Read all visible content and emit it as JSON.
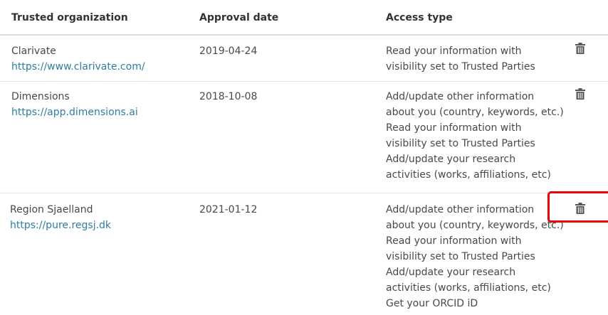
{
  "headers": {
    "organization": "Trusted organization",
    "approval_date": "Approval date",
    "access_type": "Access type"
  },
  "rows": [
    {
      "name": "Clarivate",
      "url": "https://www.clarivate.com/",
      "date": "2019-04-24",
      "access": [
        "Read your information with",
        "visibility set to Trusted Parties"
      ],
      "delete_icon": "trash-icon"
    },
    {
      "name": "Dimensions",
      "url": "https://app.dimensions.ai",
      "date": "2018-10-08",
      "access": [
        "Add/update other information",
        "about you (country, keywords, etc.)",
        "Read your information with",
        "visibility set to Trusted Parties",
        "Add/update your research",
        "activities (works, affiliations, etc)"
      ],
      "delete_icon": "trash-icon"
    },
    {
      "name": "Region Sjaelland",
      "url": "https://pure.regsj.dk",
      "date": "2021-01-12",
      "access": [
        "Add/update other information",
        "about you (country, keywords, etc.)",
        "Read your information with",
        "visibility set to Trusted Parties",
        "Add/update your research",
        "activities (works, affiliations, etc)",
        "Get your ORCID iD"
      ],
      "delete_icon": "trash-icon",
      "highlighted": true
    }
  ],
  "colors": {
    "link": "#2e7f9f",
    "text": "#494949",
    "header_text": "#333333",
    "highlight": "#e8000b"
  }
}
